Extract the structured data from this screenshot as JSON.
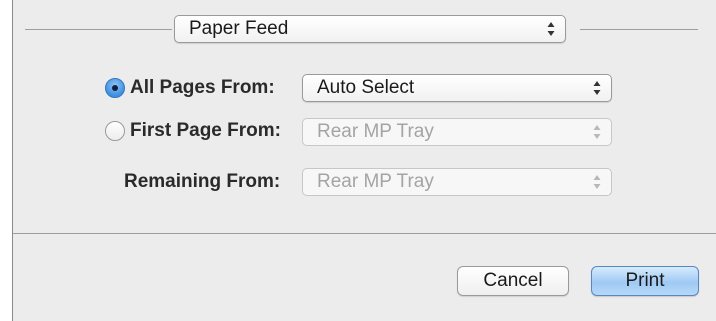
{
  "panel_selector": {
    "value": "Paper Feed"
  },
  "options": {
    "all_pages": {
      "label": "All Pages From:",
      "selected": true,
      "value": "Auto Select"
    },
    "first_page": {
      "label": "First Page From:",
      "selected": false,
      "value": "Rear MP Tray"
    },
    "remaining": {
      "label": "Remaining From:",
      "value": "Rear MP Tray"
    }
  },
  "buttons": {
    "cancel_label": "Cancel",
    "print_label": "Print"
  },
  "colors": {
    "accent": "#3f8fe0",
    "default_button": "#9fcaf4",
    "dialog_background": "#ececec",
    "disabled_text": "#a4a4a4"
  }
}
